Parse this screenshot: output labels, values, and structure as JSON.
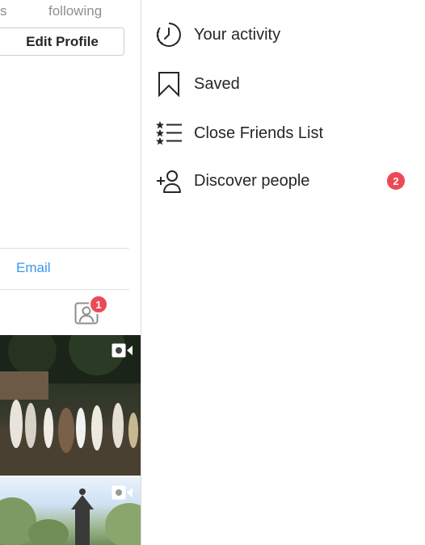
{
  "profile": {
    "stat_fragment": "s",
    "stat_following_label": "following",
    "edit_profile_label": "Edit Profile",
    "email_label": "Email",
    "tagged_badge_count": "1"
  },
  "menu": {
    "items": [
      {
        "label": "Your activity",
        "icon": "activity-icon"
      },
      {
        "label": "Saved",
        "icon": "bookmark-icon"
      },
      {
        "label": "Close Friends List",
        "icon": "close-friends-list-icon"
      },
      {
        "label": "Discover people",
        "icon": "add-person-icon",
        "badge": "2"
      }
    ]
  },
  "colors": {
    "badge": "#ed4956",
    "link": "#3897f0",
    "text": "#262626",
    "muted": "#8e8e8e"
  }
}
